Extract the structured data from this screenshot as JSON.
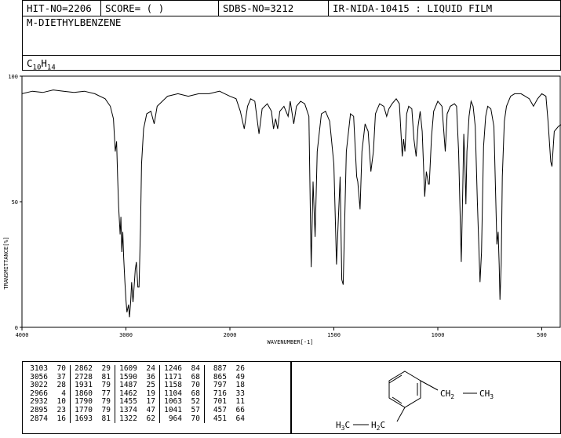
{
  "header": {
    "hit_no": "HIT-NO=2206",
    "score": "SCORE=  (   )",
    "sdbs_no": "SDBS-NO=3212",
    "ir_info": "IR-NIDA-10415 : LIQUID FILM"
  },
  "compound_name": "M-DIETHYLBENZENE",
  "formula": {
    "C": "C",
    "c_count": "10",
    "H": "H",
    "h_count": "14"
  },
  "chart_data": {
    "type": "line",
    "xlabel": "WAVENUMBER[-1]",
    "ylabel": "TRANSMITTANCE[%]",
    "xlim": [
      4000,
      400
    ],
    "ylim": [
      0,
      100
    ],
    "x_ticks": [
      4000,
      3000,
      2000,
      1500,
      1000,
      500
    ],
    "y_ticks": [
      0,
      50,
      100
    ],
    "series": [
      {
        "points": [
          [
            4000,
            93
          ],
          [
            3900,
            94
          ],
          [
            3800,
            93.5
          ],
          [
            3700,
            94.5
          ],
          [
            3600,
            94
          ],
          [
            3500,
            93.5
          ],
          [
            3400,
            94
          ],
          [
            3300,
            93
          ],
          [
            3200,
            91
          ],
          [
            3150,
            88
          ],
          [
            3120,
            83
          ],
          [
            3103,
            70
          ],
          [
            3090,
            74
          ],
          [
            3080,
            60
          ],
          [
            3070,
            48
          ],
          [
            3056,
            37
          ],
          [
            3048,
            44
          ],
          [
            3040,
            30
          ],
          [
            3030,
            38
          ],
          [
            3022,
            28
          ],
          [
            3010,
            18
          ],
          [
            3000,
            11
          ],
          [
            2990,
            6
          ],
          [
            2975,
            9
          ],
          [
            2966,
            4
          ],
          [
            2955,
            10
          ],
          [
            2945,
            18
          ],
          [
            2932,
            10
          ],
          [
            2920,
            17
          ],
          [
            2910,
            23
          ],
          [
            2900,
            26
          ],
          [
            2895,
            23
          ],
          [
            2885,
            16
          ],
          [
            2874,
            16
          ],
          [
            2860,
            40
          ],
          [
            2850,
            65
          ],
          [
            2830,
            79
          ],
          [
            2800,
            85
          ],
          [
            2760,
            86
          ],
          [
            2728,
            81
          ],
          [
            2700,
            88
          ],
          [
            2650,
            90
          ],
          [
            2600,
            92
          ],
          [
            2500,
            93
          ],
          [
            2400,
            92
          ],
          [
            2300,
            93
          ],
          [
            2200,
            93
          ],
          [
            2100,
            94
          ],
          [
            2050,
            93
          ],
          [
            2000,
            92
          ],
          [
            1970,
            91
          ],
          [
            1950,
            86
          ],
          [
            1931,
            79
          ],
          [
            1915,
            88
          ],
          [
            1900,
            91
          ],
          [
            1880,
            90
          ],
          [
            1860,
            77
          ],
          [
            1845,
            87
          ],
          [
            1820,
            89
          ],
          [
            1800,
            86
          ],
          [
            1790,
            79
          ],
          [
            1780,
            83
          ],
          [
            1770,
            79
          ],
          [
            1760,
            86
          ],
          [
            1740,
            88
          ],
          [
            1720,
            84
          ],
          [
            1710,
            90
          ],
          [
            1693,
            81
          ],
          [
            1680,
            88
          ],
          [
            1660,
            90
          ],
          [
            1640,
            89
          ],
          [
            1620,
            84
          ],
          [
            1609,
            24
          ],
          [
            1600,
            58
          ],
          [
            1590,
            36
          ],
          [
            1580,
            70
          ],
          [
            1560,
            85
          ],
          [
            1540,
            86
          ],
          [
            1520,
            82
          ],
          [
            1500,
            65
          ],
          [
            1487,
            25
          ],
          [
            1480,
            40
          ],
          [
            1470,
            60
          ],
          [
            1462,
            19
          ],
          [
            1455,
            17
          ],
          [
            1440,
            70
          ],
          [
            1420,
            85
          ],
          [
            1405,
            84
          ],
          [
            1390,
            60
          ],
          [
            1385,
            58
          ],
          [
            1374,
            47
          ],
          [
            1365,
            70
          ],
          [
            1350,
            81
          ],
          [
            1335,
            78
          ],
          [
            1322,
            62
          ],
          [
            1310,
            70
          ],
          [
            1300,
            85
          ],
          [
            1290,
            87
          ],
          [
            1280,
            89
          ],
          [
            1260,
            88
          ],
          [
            1246,
            84
          ],
          [
            1235,
            87
          ],
          [
            1220,
            89
          ],
          [
            1200,
            91
          ],
          [
            1185,
            89
          ],
          [
            1171,
            68
          ],
          [
            1165,
            75
          ],
          [
            1158,
            70
          ],
          [
            1150,
            85
          ],
          [
            1140,
            88
          ],
          [
            1125,
            87
          ],
          [
            1115,
            75
          ],
          [
            1104,
            68
          ],
          [
            1095,
            80
          ],
          [
            1085,
            86
          ],
          [
            1075,
            78
          ],
          [
            1063,
            52
          ],
          [
            1055,
            62
          ],
          [
            1045,
            57
          ],
          [
            1041,
            57
          ],
          [
            1030,
            76
          ],
          [
            1020,
            86
          ],
          [
            1000,
            90
          ],
          [
            990,
            89
          ],
          [
            980,
            88
          ],
          [
            964,
            70
          ],
          [
            955,
            85
          ],
          [
            940,
            88
          ],
          [
            920,
            89
          ],
          [
            910,
            88
          ],
          [
            900,
            70
          ],
          [
            887,
            26
          ],
          [
            880,
            55
          ],
          [
            875,
            77
          ],
          [
            870,
            65
          ],
          [
            865,
            49
          ],
          [
            860,
            70
          ],
          [
            850,
            84
          ],
          [
            840,
            90
          ],
          [
            830,
            88
          ],
          [
            820,
            80
          ],
          [
            810,
            50
          ],
          [
            797,
            18
          ],
          [
            790,
            30
          ],
          [
            780,
            72
          ],
          [
            770,
            84
          ],
          [
            760,
            88
          ],
          [
            745,
            87
          ],
          [
            730,
            80
          ],
          [
            716,
            33
          ],
          [
            710,
            38
          ],
          [
            705,
            25
          ],
          [
            701,
            11
          ],
          [
            695,
            25
          ],
          [
            690,
            60
          ],
          [
            680,
            82
          ],
          [
            670,
            88
          ],
          [
            650,
            92
          ],
          [
            630,
            93
          ],
          [
            600,
            93
          ],
          [
            580,
            92
          ],
          [
            560,
            91
          ],
          [
            540,
            88
          ],
          [
            520,
            91
          ],
          [
            500,
            93
          ],
          [
            480,
            92
          ],
          [
            470,
            82
          ],
          [
            457,
            66
          ],
          [
            451,
            64
          ],
          [
            440,
            78
          ],
          [
            420,
            80
          ],
          [
            400,
            81
          ]
        ]
      }
    ]
  },
  "peak_table": {
    "columns": [
      [
        [
          "3103",
          "70"
        ],
        [
          "3056",
          "37"
        ],
        [
          "3022",
          "28"
        ],
        [
          "2966",
          "4"
        ],
        [
          "2932",
          "10"
        ],
        [
          "2895",
          "23"
        ],
        [
          "2874",
          "16"
        ]
      ],
      [
        [
          "2862",
          "29"
        ],
        [
          "2728",
          "81"
        ],
        [
          "1931",
          "79"
        ],
        [
          "1860",
          "77"
        ],
        [
          "1790",
          "79"
        ],
        [
          "1770",
          "79"
        ],
        [
          "1693",
          "81"
        ]
      ],
      [
        [
          "1609",
          "24"
        ],
        [
          "1590",
          "36"
        ],
        [
          "1487",
          "25"
        ],
        [
          "1462",
          "19"
        ],
        [
          "1455",
          "17"
        ],
        [
          "1374",
          "47"
        ],
        [
          "1322",
          "62"
        ]
      ],
      [
        [
          "1246",
          "84"
        ],
        [
          "1171",
          "68"
        ],
        [
          "1158",
          "70"
        ],
        [
          "1104",
          "68"
        ],
        [
          "1063",
          "52"
        ],
        [
          "1041",
          "57"
        ],
        [
          "964",
          "70"
        ]
      ],
      [
        [
          "887",
          "26"
        ],
        [
          "865",
          "49"
        ],
        [
          "797",
          "18"
        ],
        [
          "716",
          "33"
        ],
        [
          "701",
          "11"
        ],
        [
          "457",
          "66"
        ],
        [
          "451",
          "64"
        ]
      ]
    ]
  },
  "structure": {
    "right_group": "CH",
    "right_group_sub": "2",
    "right_end": "CH",
    "right_end_sub": "3",
    "left_end": "H",
    "left_end_sub": "3",
    "left_end_c": "C",
    "left_group": "H",
    "left_group_sub": "2",
    "left_group_c": "C"
  }
}
